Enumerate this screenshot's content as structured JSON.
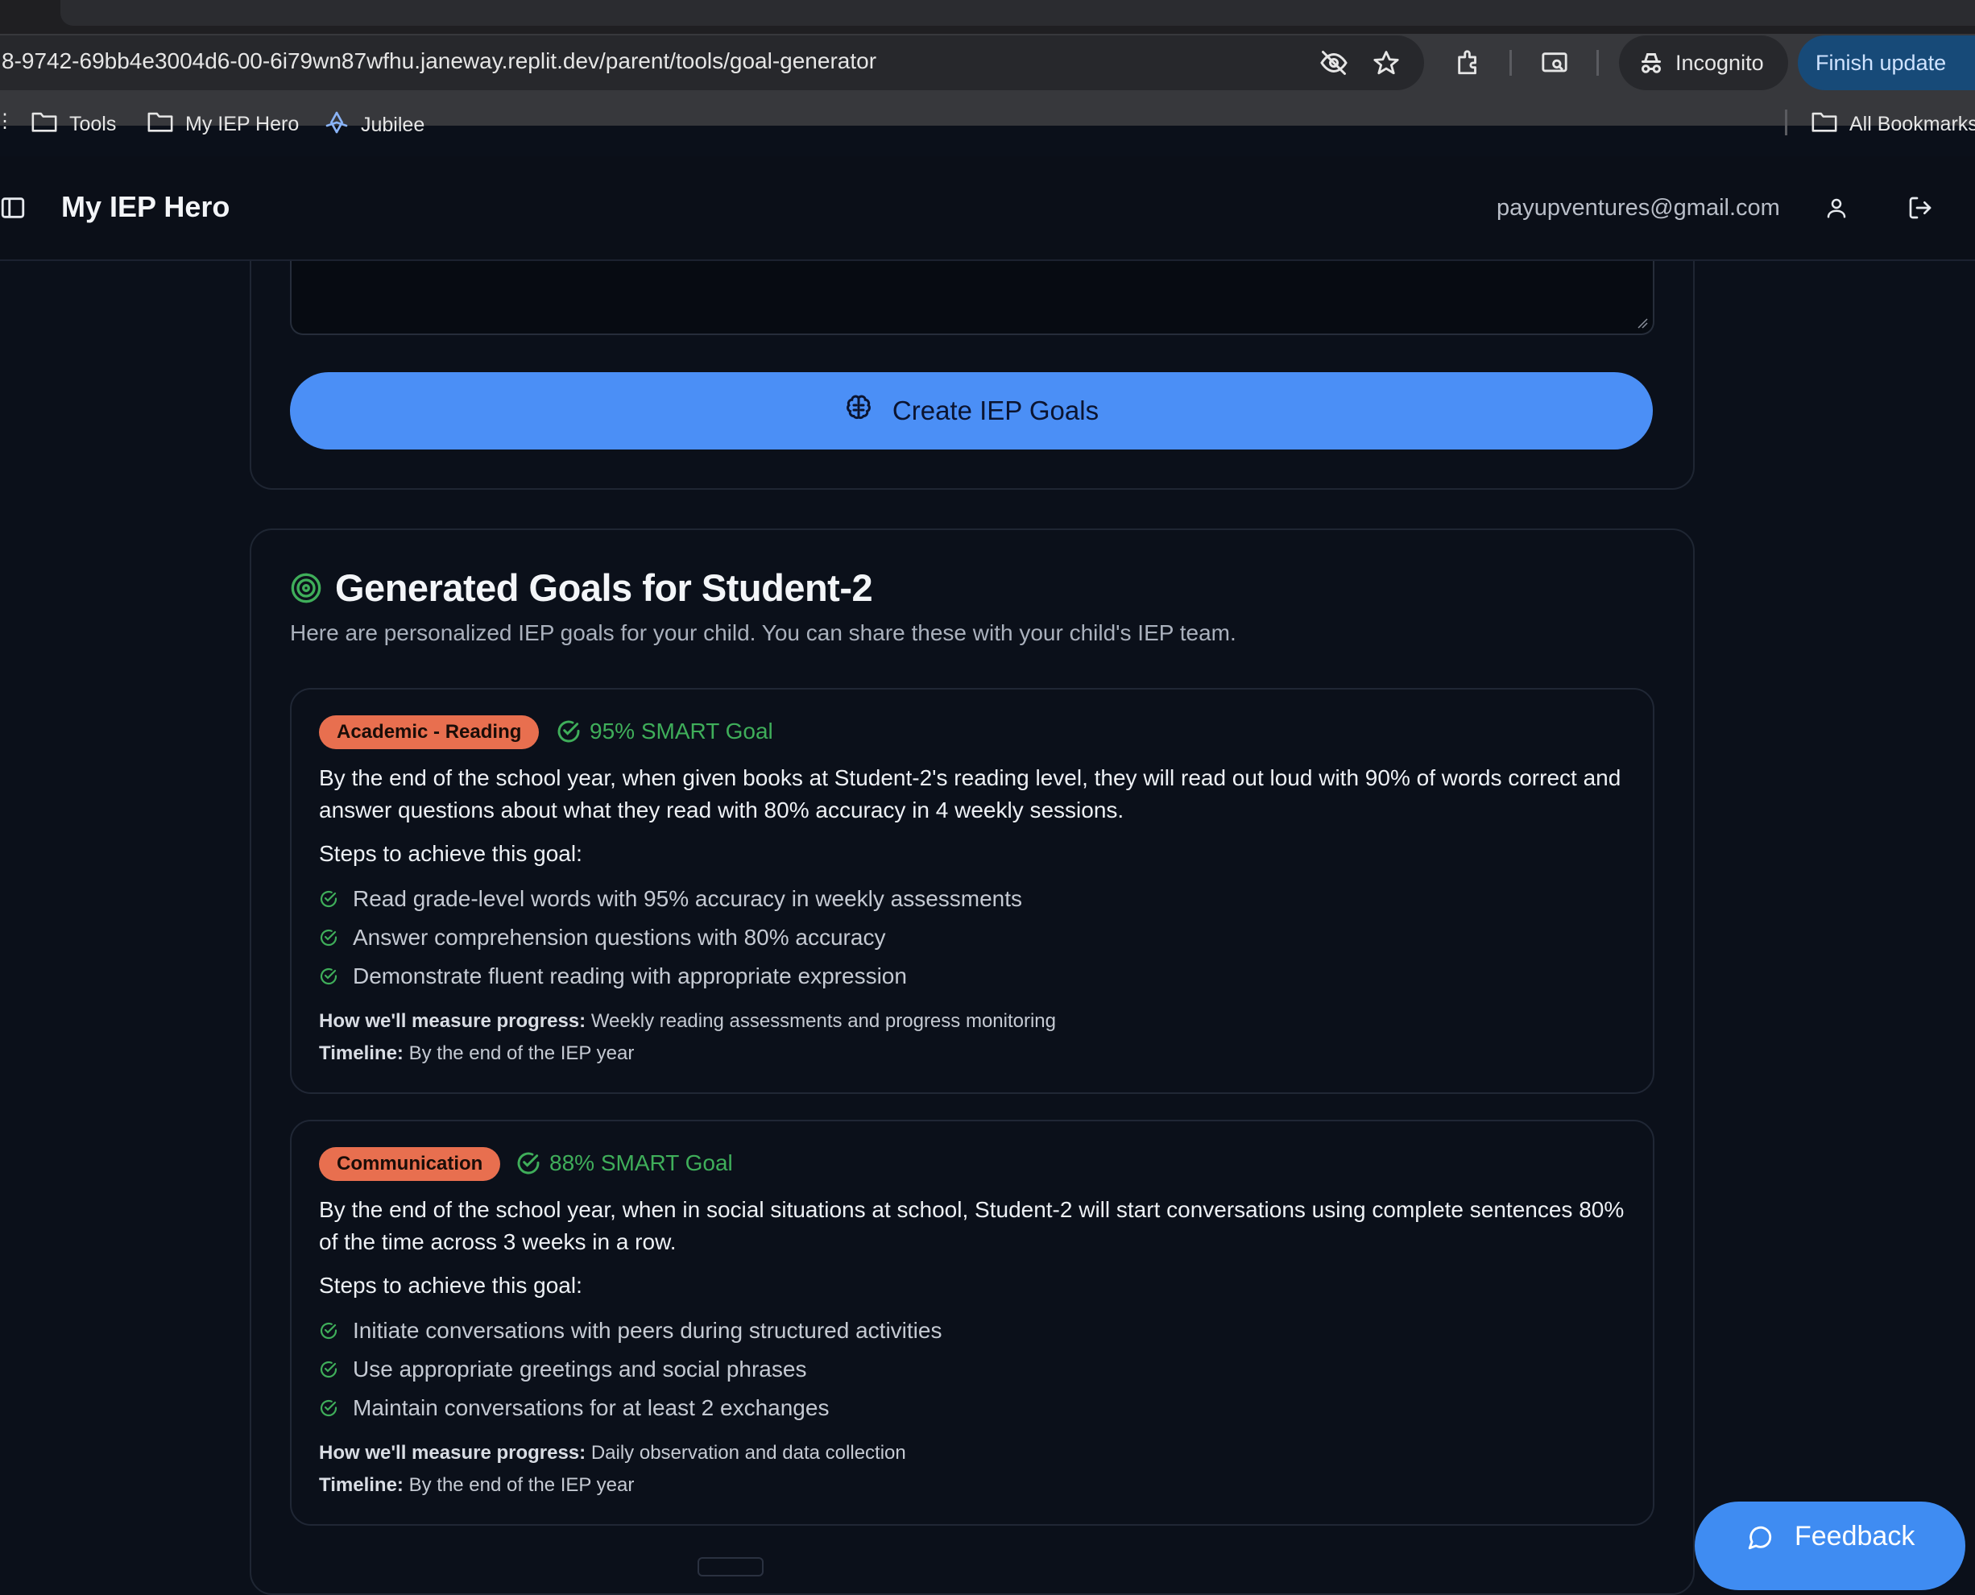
{
  "browser": {
    "url": "8-9742-69bb4e3004d6-00-6i79wn87wfhu.janeway.replit.dev/parent/tools/goal-generator",
    "incognito_label": "Incognito",
    "finish_update_label": "Finish update",
    "bookmarks": [
      {
        "label": "Tools",
        "icon": "folder-icon"
      },
      {
        "label": "My IEP Hero",
        "icon": "folder-icon"
      },
      {
        "label": "Jubilee",
        "icon": "jubilee-icon"
      }
    ],
    "all_bookmarks_label": "All Bookmarks"
  },
  "header": {
    "app_title": "My IEP Hero",
    "email": "payupventures@gmail.com"
  },
  "form": {
    "create_button_label": "Create IEP Goals"
  },
  "results": {
    "title": "Generated Goals for Student-2",
    "subtitle": "Here are personalized IEP goals for your child. You can share these with your child's IEP team.",
    "goals": [
      {
        "category": "Academic - Reading",
        "smart_score": "95% SMART Goal",
        "description": "By the end of the school year, when given books at Student-2's reading level, they will read out loud with 90% of words correct and answer questions about what they read with 80% accuracy in 4 weekly sessions.",
        "steps_heading": "Steps to achieve this goal:",
        "steps": [
          "Read grade-level words with 95% accuracy in weekly assessments",
          "Answer comprehension questions with 80% accuracy",
          "Demonstrate fluent reading with appropriate expression"
        ],
        "measure_label": "How we'll measure progress:",
        "measure_value": "Weekly reading assessments and progress monitoring",
        "timeline_label": "Timeline:",
        "timeline_value": "By the end of the IEP year"
      },
      {
        "category": "Communication",
        "smart_score": "88% SMART Goal",
        "description": "By the end of the school year, when in social situations at school, Student-2 will start conversations using complete sentences 80% of the time across 3 weeks in a row.",
        "steps_heading": "Steps to achieve this goal:",
        "steps": [
          "Initiate conversations with peers during structured activities",
          "Use appropriate greetings and social phrases",
          "Maintain conversations for at least 2 exchanges"
        ],
        "measure_label": "How we'll measure progress:",
        "measure_value": "Daily observation and data collection",
        "timeline_label": "Timeline:",
        "timeline_value": "By the end of the IEP year"
      }
    ]
  },
  "feedback_label": "Feedback",
  "colors": {
    "accent_blue": "#4b8ff6",
    "badge_orange": "#e86f4f",
    "smart_green": "#3fae5a",
    "background": "#0b101a"
  }
}
